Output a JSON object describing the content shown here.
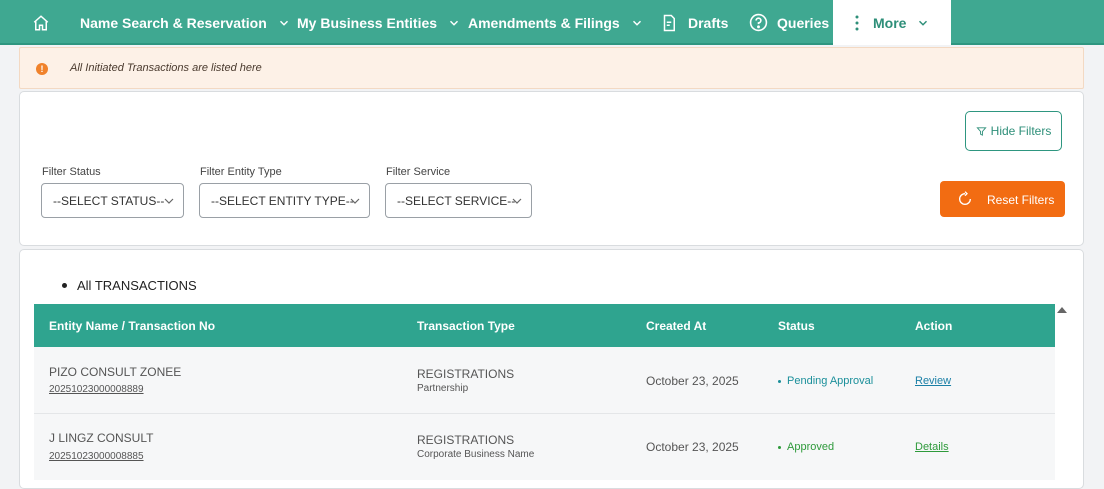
{
  "nav": {
    "items": [
      {
        "label": "Name Search & Reservation",
        "icon": "chevron-down-icon"
      },
      {
        "label": "My Business Entities",
        "icon": "chevron-down-icon"
      },
      {
        "label": "Amendments & Filings",
        "icon": "chevron-down-icon"
      },
      {
        "label": "Drafts",
        "icon": "drafts-icon"
      },
      {
        "label": "Queries",
        "icon": "question-circle-icon"
      },
      {
        "label": "More",
        "icon": "kebab-icon"
      }
    ],
    "home_icon": "home-icon"
  },
  "alert": {
    "icon": "exclamation-icon",
    "text": "All Initiated Transactions are listed here"
  },
  "filters": {
    "hide_label": "Hide Filters",
    "status_label": "Filter Status",
    "status_value": "--SELECT STATUS--",
    "entity_label": "Filter Entity Type",
    "entity_value": "--SELECT ENTITY TYPE--",
    "service_label": "Filter Service",
    "service_value": "--SELECT SERVICE--",
    "reset_label": "Reset Filters"
  },
  "table": {
    "tab_label": "All TRANSACTIONS",
    "headers": [
      "Entity Name / Transaction No",
      "Transaction Type",
      "Created At",
      "Status",
      "Action"
    ],
    "rows": [
      {
        "entity_name": "PIZO CONSULT ZONEE",
        "transaction_no": "20251023000008889",
        "type": "REGISTRATIONS",
        "subtype": "Partnership",
        "created_at": "October 23, 2025",
        "status": "Pending Approval",
        "status_color": "#1a8f9a",
        "action": "Review",
        "action_color": "#1a7fa6"
      },
      {
        "entity_name": "J LINGZ CONSULT",
        "transaction_no": "20251023000008885",
        "type": "REGISTRATIONS",
        "subtype": "Corporate Business Name",
        "created_at": "October 23, 2025",
        "status": "Approved",
        "status_color": "#2e9a3b",
        "action": "Details",
        "action_color": "#2e9a3b"
      }
    ]
  },
  "colors": {
    "nav_bg": "#3fa891",
    "header_bg": "#2fa48f",
    "accent_orange": "#f26c12"
  }
}
